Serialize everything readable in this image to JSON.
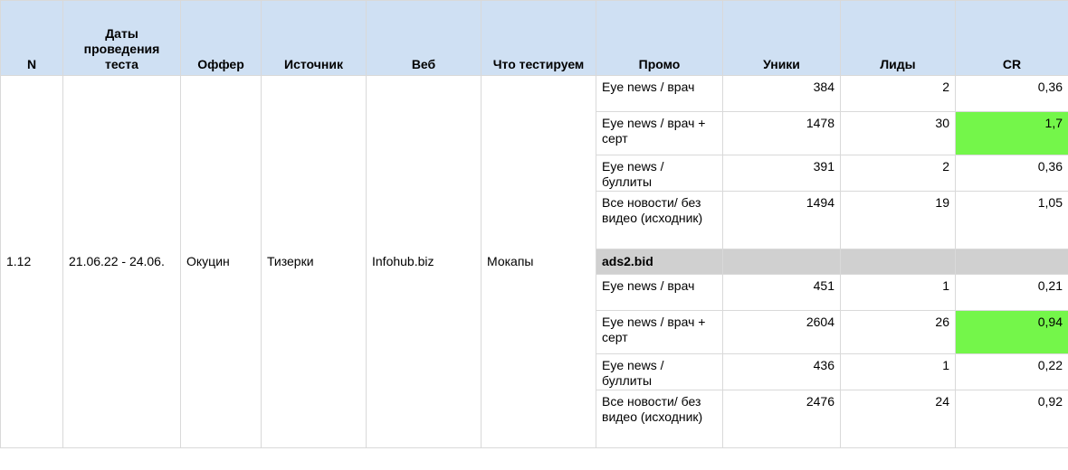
{
  "headers": {
    "n": "N",
    "dates": "Даты проведения теста",
    "offer": "Оффер",
    "source": "Источник",
    "web": "Веб",
    "what_testing": "Что тестируем",
    "promo": "Промо",
    "uniques": "Уники",
    "leads": "Лиды",
    "cr": "CR"
  },
  "test": {
    "n": "1.12",
    "dates": "21.06.22 - 24.06.",
    "offer": "Окуцин",
    "source": "Тизерки",
    "web": "Infohub.biz",
    "what_testing": "Мокапы"
  },
  "group1_rows": [
    {
      "promo": "Eye news / врач",
      "uniques": "384",
      "leads": "2",
      "cr": "0,36"
    },
    {
      "promo": "Eye news / врач + серт",
      "uniques": "1478",
      "leads": "30",
      "cr": "1,7"
    },
    {
      "promo": "Eye news / буллиты",
      "uniques": "391",
      "leads": "2",
      "cr": "0,36"
    },
    {
      "promo": "Все новости/ без видео (исходник)",
      "uniques": "1494",
      "leads": "19",
      "cr": "1,05"
    }
  ],
  "subheader": "ads2.bid",
  "group2_rows": [
    {
      "promo": "Eye news / врач",
      "uniques": "451",
      "leads": "1",
      "cr": "0,21"
    },
    {
      "promo": "Eye news / врач + серт",
      "uniques": "2604",
      "leads": "26",
      "cr": "0,94"
    },
    {
      "promo": "Eye news / буллиты",
      "uniques": "436",
      "leads": "1",
      "cr": "0,22"
    },
    {
      "promo": "Все новости/ без видео (исходник)",
      "uniques": "2476",
      "leads": "24",
      "cr": "0,92"
    }
  ],
  "colors": {
    "header_bg": "#cfe0f3",
    "highlight": "#74f64a",
    "subheader_bg": "#d0d0d0",
    "grid": "#d9d9d9"
  }
}
